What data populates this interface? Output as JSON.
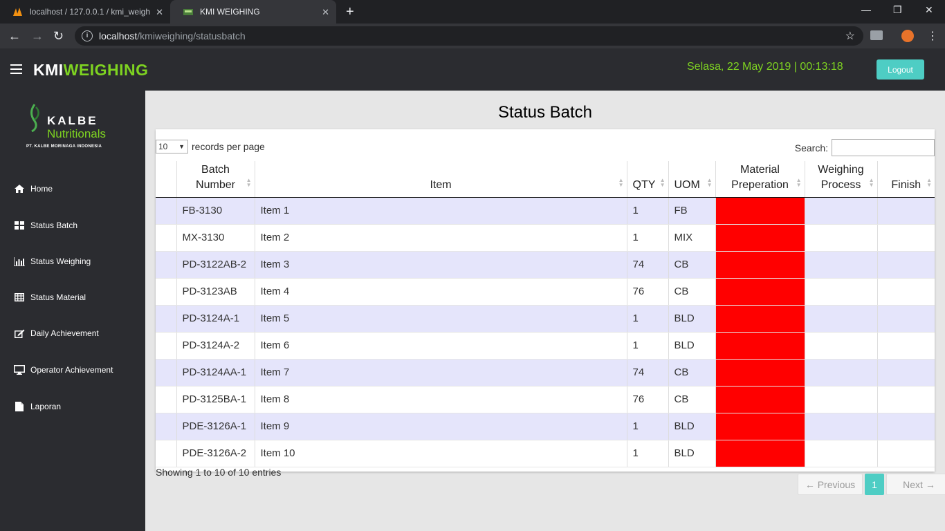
{
  "browser": {
    "tabs": [
      {
        "title": "localhost / 127.0.0.1 / kmi_weigh"
      },
      {
        "title": "KMI WEIGHING"
      }
    ],
    "url_host": "localhost",
    "url_path": "/kmiweighing/statusbatch"
  },
  "header": {
    "brand_a": "KMI",
    "brand_b": "WEIGHING",
    "datetime": "Selasa, 22 May 2019 | 00:13:18",
    "logout": "Logout"
  },
  "logo": {
    "line1": "KALBE",
    "line2": "Nutritionals",
    "line3": "PT. KALBE MORINAGA INDONESIA"
  },
  "sidebar": {
    "items": [
      {
        "label": "Home",
        "icon": "home-icon"
      },
      {
        "label": "Status Batch",
        "icon": "grid-icon"
      },
      {
        "label": "Status Weighing",
        "icon": "bar-chart-icon"
      },
      {
        "label": "Status Material",
        "icon": "table-icon"
      },
      {
        "label": "Daily Achievement",
        "icon": "edit-icon"
      },
      {
        "label": "Operator Achievement",
        "icon": "desktop-icon"
      },
      {
        "label": "Laporan",
        "icon": "file-icon"
      }
    ]
  },
  "page": {
    "title": "Status Batch",
    "length_value": "10",
    "length_label": "records per page",
    "search_label": "Search:",
    "search_value": "",
    "info": "Showing 1 to 10 of 10 entries",
    "prev": "← Previous",
    "page_num": "1",
    "next": "Next →"
  },
  "table": {
    "columns": [
      "Batch Number",
      "Item",
      "QTY",
      "UOM",
      "Material Preperation",
      "Weighing Process",
      "Finish"
    ],
    "status_colors": {
      "material_preparation": "#ff0000"
    },
    "rows": [
      {
        "batch": "FB-3130",
        "item": "Item 1",
        "qty": "1",
        "uom": "FB"
      },
      {
        "batch": "MX-3130",
        "item": "Item 2",
        "qty": "1",
        "uom": "MIX"
      },
      {
        "batch": "PD-3122AB-2",
        "item": "Item 3",
        "qty": "74",
        "uom": "CB"
      },
      {
        "batch": "PD-3123AB",
        "item": "Item 4",
        "qty": "76",
        "uom": "CB"
      },
      {
        "batch": "PD-3124A-1",
        "item": "Item 5",
        "qty": "1",
        "uom": "BLD"
      },
      {
        "batch": "PD-3124A-2",
        "item": "Item 6",
        "qty": "1",
        "uom": "BLD"
      },
      {
        "batch": "PD-3124AA-1",
        "item": "Item 7",
        "qty": "74",
        "uom": "CB"
      },
      {
        "batch": "PD-3125BA-1",
        "item": "Item 8",
        "qty": "76",
        "uom": "CB"
      },
      {
        "batch": "PDE-3126A-1",
        "item": "Item 9",
        "qty": "1",
        "uom": "BLD"
      },
      {
        "batch": "PDE-3126A-2",
        "item": "Item 10",
        "qty": "1",
        "uom": "BLD"
      }
    ]
  }
}
